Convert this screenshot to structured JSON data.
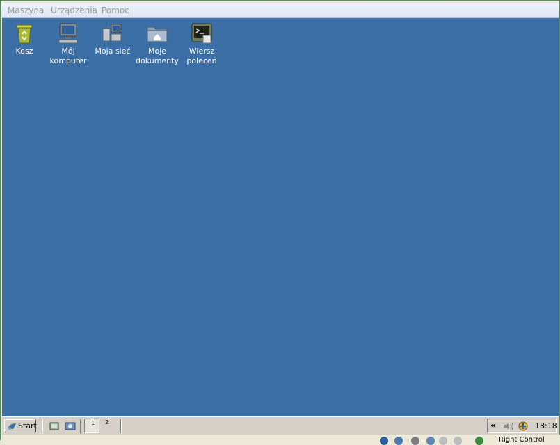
{
  "menu": {
    "items": [
      {
        "label": "Maszyna"
      },
      {
        "label": "Urządzenia"
      },
      {
        "label": "Pomoc"
      }
    ]
  },
  "desktop": {
    "background_color": "#3a6ea5",
    "icons": [
      {
        "label": "Kosz",
        "icon": "recycle-bin-icon"
      },
      {
        "label": "Mój komputer",
        "icon": "computer-icon"
      },
      {
        "label": "Moja sieć",
        "icon": "network-icon"
      },
      {
        "label": "Moje dokumenty",
        "icon": "documents-folder-icon"
      },
      {
        "label": "Wiersz poleceń",
        "icon": "terminal-icon"
      }
    ]
  },
  "taskbar": {
    "start_label": "Start",
    "pager": [
      "1",
      "2"
    ],
    "clock": "18:18",
    "tray_arrow": "«"
  },
  "statusbar": {
    "host_key_text": "Right Control"
  }
}
